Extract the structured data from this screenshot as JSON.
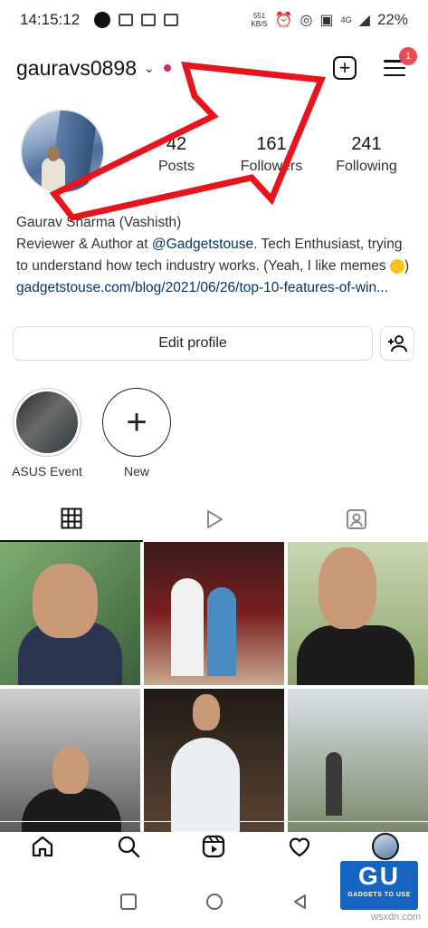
{
  "status_bar": {
    "time": "14:15:12",
    "speed_value": "551",
    "speed_unit": "KB/S",
    "network": "4G",
    "battery": "22%"
  },
  "header": {
    "username": "gauravs0898",
    "menu_badge": "1"
  },
  "stats": [
    {
      "num": "42",
      "label": "Posts"
    },
    {
      "num": "161",
      "label": "Followers"
    },
    {
      "num": "241",
      "label": "Following"
    }
  ],
  "bio": {
    "name": "Gaurav Sharma (Vashisth)",
    "line1_prefix": "Reviewer & Author at ",
    "mention": "@Gadgetstouse",
    "line1_suffix": ". Tech Enthusiast, trying to understand how tech industry works. (Yeah, I like memes ",
    "line_end": ")",
    "link": "gadgetstouse.com/blog/2021/06/26/top-10-features-of-win..."
  },
  "buttons": {
    "edit_profile": "Edit profile"
  },
  "highlights": [
    {
      "label": "ASUS Event"
    },
    {
      "label": "New"
    }
  ],
  "watermark": {
    "logo": "GU",
    "tagline": "GADGETS TO USE",
    "site": "wsxdn.com"
  },
  "colors": {
    "accent_red": "#e0245e",
    "badge_red": "#ed4956",
    "arrow_red": "#e8141b",
    "link_blue": "#00376b"
  }
}
